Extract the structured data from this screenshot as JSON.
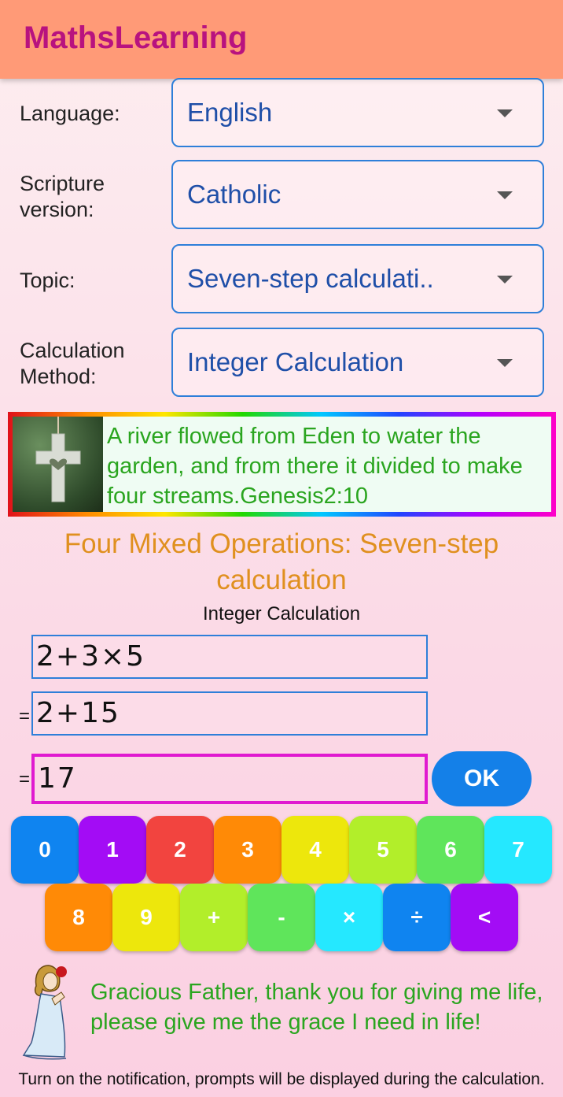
{
  "app": {
    "title": "MathsLearning"
  },
  "form": {
    "language": {
      "label": "Language:",
      "value": "English"
    },
    "scripture": {
      "label_line1": "Scripture",
      "label_line2": "version:",
      "value": "Catholic"
    },
    "topic": {
      "label": "Topic:",
      "value": "Seven-step calculati.."
    },
    "method": {
      "label_line1": "Calculation",
      "label_line2": "Method:",
      "value": "Integer Calculation"
    }
  },
  "verse": {
    "image_icon": "cross-pendant-icon",
    "text": "A river flowed from Eden to water the garden, and from there it divided to make four streams.Genesis2:10"
  },
  "lesson": {
    "title": "Four Mixed Operations: Seven-step calculation",
    "method": "Integer Calculation"
  },
  "equation": {
    "expression": "2+3×5",
    "step1": "2+15",
    "answer": "17",
    "equals": "=",
    "ok_label": "OK"
  },
  "keypad": {
    "row1": [
      {
        "label": "0",
        "color": "#0f84f0"
      },
      {
        "label": "1",
        "color": "#a30cf5"
      },
      {
        "label": "2",
        "color": "#f2443f"
      },
      {
        "label": "3",
        "color": "#ff8a06"
      },
      {
        "label": "4",
        "color": "#ede70c"
      },
      {
        "label": "5",
        "color": "#b2ee2a"
      },
      {
        "label": "6",
        "color": "#5fe55b"
      },
      {
        "label": "7",
        "color": "#25e8ff"
      }
    ],
    "row2": [
      {
        "label": "8",
        "color": "#ff8a06"
      },
      {
        "label": "9",
        "color": "#ede70c"
      },
      {
        "label": "+",
        "color": "#b2ee2a"
      },
      {
        "label": "-",
        "color": "#5fe55b"
      },
      {
        "label": "×",
        "color": "#25e8ff"
      },
      {
        "label": "÷",
        "color": "#0f84f0"
      },
      {
        "label": "<",
        "color": "#a30cf5"
      }
    ]
  },
  "prayer": {
    "image_icon": "praying-girl-icon",
    "text": "Gracious Father, thank you for giving me life, please give me the grace I need in life!"
  },
  "notice": "Turn on the notification, prompts will be displayed during the calculation."
}
